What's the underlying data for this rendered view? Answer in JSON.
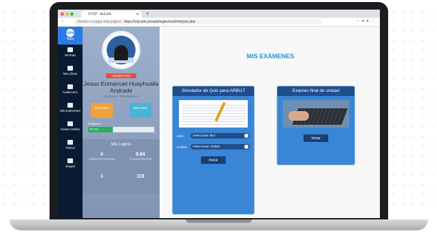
{
  "browser": {
    "tab_title": "VTCP - AULAS",
    "url_hint": "Stamos a cargar esta página",
    "url": "https://vcp.edu.pe/aula/ingles/evalInfoQuiz.php"
  },
  "nav": {
    "logo_text": "icpna",
    "logo_sub": "Aula",
    "items": [
      {
        "label": "Mi Ruta"
      },
      {
        "label": "Mis Libros"
      },
      {
        "label": "Audiciones"
      },
      {
        "label": "Mis Exámenes"
      },
      {
        "label": "Clases Online"
      },
      {
        "label": "Videos"
      },
      {
        "label": "Juegos"
      }
    ]
  },
  "profile": {
    "change_photo": "Cambiar Foto",
    "name": "Jesus Enmanuel Huayhualla Andrade",
    "role": "Estudiante, Nivel Básico 3",
    "btn_left": "Mis Datos",
    "btn_right": "Mis Notas",
    "progress_label": "Progreso",
    "progress_value": "37.5%",
    "progress_fraction": 0.375,
    "achievements_title": "Mis Logros",
    "achievements": [
      {
        "value": "0",
        "label": "Exámenes Resueltos"
      },
      {
        "value": "9.84",
        "label": "Promedio General"
      },
      {
        "value": "1",
        "label": ""
      },
      {
        "value": "119",
        "label": ""
      }
    ]
  },
  "main": {
    "title": "MIS EXÁMENES",
    "cards": [
      {
        "title": "Simulador de Quiz para ARBI17",
        "selects": [
          {
            "label": "Libro",
            "value": "Seleccionar libro"
          },
          {
            "label": "Unidad",
            "value": "Seleccionar Unidad"
          }
        ],
        "button": "Iniciar"
      },
      {
        "title": "Examen final de unidad",
        "button": "Iniciar"
      }
    ]
  },
  "colors": {
    "nav_bg": "#0a1a33",
    "accent": "#2c8fd6",
    "card_head": "#1f4e8c",
    "card_bg": "#3a86d6",
    "orange": "#f0a23a",
    "teal": "#4ab3d9",
    "progress": "#27ae60"
  }
}
